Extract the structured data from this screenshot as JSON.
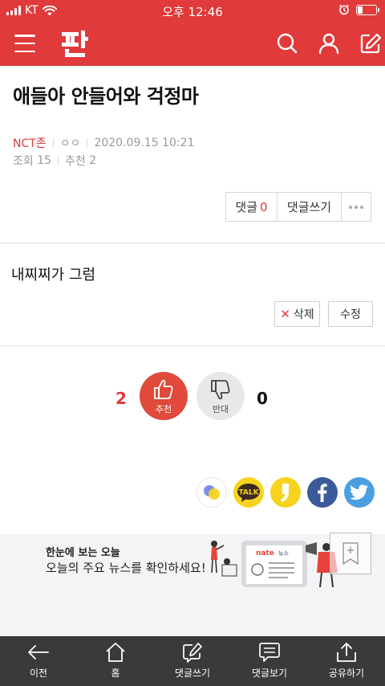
{
  "status": {
    "carrier": "KT",
    "time": "오후 12:46"
  },
  "post": {
    "title": "애들아 안들어와 걱정마",
    "author": "NCT존",
    "nickname": "ㅇㅇ",
    "date": "2020.09.15 10:21",
    "views_label": "조회",
    "views": "15",
    "recommend_label": "추천",
    "recommend": "2",
    "body": "내찌찌가 그럼"
  },
  "actions": {
    "comment_label": "댓글",
    "comment_count": "0",
    "write_comment": "댓글쓰기",
    "delete": "삭제",
    "delete_x": "✕",
    "edit": "수정"
  },
  "vote": {
    "up_count": "2",
    "up_label": "추천",
    "down_count": "0",
    "down_label": "반대"
  },
  "share": {
    "kakao_talk_label": "TALK"
  },
  "banner": {
    "line1": "한눈에 보는 오늘",
    "line2": "오늘의 주요 뉴스를 확인하세요!",
    "brand": "nate",
    "brand_sub": "뉴스"
  },
  "bottom_nav": {
    "back": "이전",
    "home": "홈",
    "write_comment": "댓글쓰기",
    "view_comments": "댓글보기",
    "share": "공유하기"
  },
  "colors": {
    "brand_red": "#e03a3a",
    "facebook": "#3b5a9a",
    "twitter": "#4a9fe0",
    "kakao_yellow": "#f7d320"
  }
}
